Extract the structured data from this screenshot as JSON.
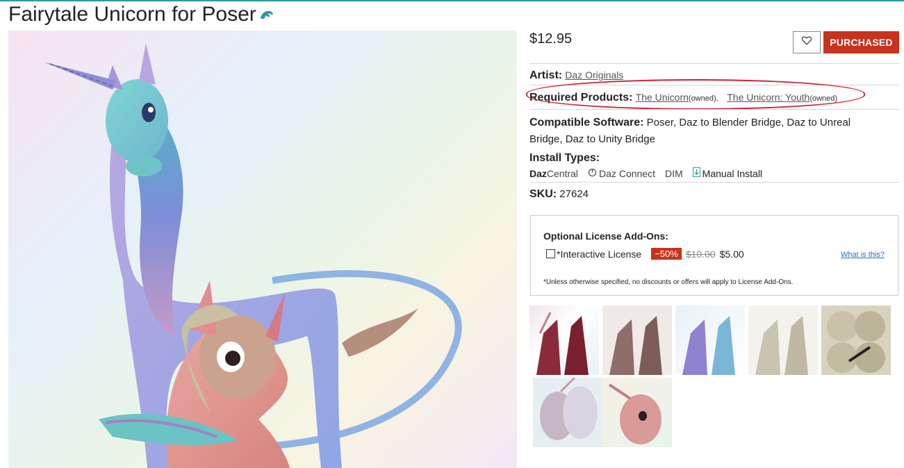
{
  "product": {
    "title": "Fairytale Unicorn for Poser",
    "poser_icon": "poser-horse-icon"
  },
  "pricing": {
    "price": "$12.95",
    "purchased_label": "PURCHASED",
    "wishlist_icon": "heart-icon"
  },
  "details": {
    "artist_label": "Artist:",
    "artist_value": "Daz Originals",
    "required_label": "Required Products:",
    "required_items": [
      {
        "name": "The Unicorn",
        "status": "(owned)"
      },
      {
        "name": "The Unicorn: Youth",
        "status": "(owned)"
      }
    ],
    "required_separator": ",",
    "compatible_label": "Compatible Software:",
    "compatible_line1": "Poser, Daz to Blender Bridge, Daz to Unreal",
    "compatible_line2": "Bridge, Daz to Unity Bridge",
    "install_label": "Install Types:",
    "install_types": {
      "dazcentral_bold": "Daz",
      "dazcentral_rest": "Central",
      "daz_connect": "Daz Connect",
      "dim": "DIM",
      "manual": "Manual Install"
    },
    "sku_label": "SKU:",
    "sku_value": "27624"
  },
  "license": {
    "title": "Optional License Add-Ons:",
    "item_label": "*Interactive License",
    "discount": "−50%",
    "old_price": "$10.00",
    "new_price": "$5.00",
    "help_link": "What is this?",
    "note": "*Unless otherwise specified, no discounts or offers will apply to License Add-Ons."
  },
  "colors": {
    "accent": "#c8321e",
    "teal": "#2a9aa3",
    "highlight": "#cc2233"
  }
}
